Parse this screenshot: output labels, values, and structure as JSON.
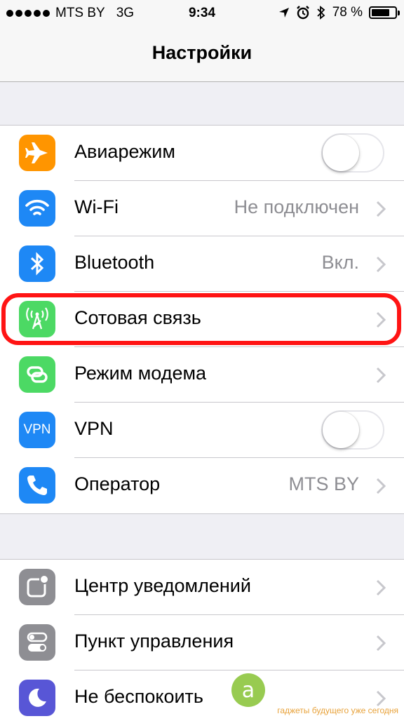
{
  "status_bar": {
    "carrier": "MTS BY",
    "network": "3G",
    "time": "9:34",
    "battery": "78 %",
    "battery_level": 0.78,
    "signal_bars": 5,
    "icons": [
      "location-icon",
      "alarm-icon",
      "bluetooth-icon"
    ]
  },
  "nav": {
    "title": "Настройки"
  },
  "group1": [
    {
      "label": "Авиарежим",
      "icon": "airplane-icon",
      "color": "#ff9500",
      "toggle": false
    },
    {
      "label": "Wi-Fi",
      "icon": "wifi-icon",
      "color": "#1e88f5",
      "value": "Не подключен"
    },
    {
      "label": "Bluetooth",
      "icon": "bluetooth-icon",
      "color": "#1e88f5",
      "value": "Вкл."
    },
    {
      "label": "Сотовая связь",
      "icon": "cellular-icon",
      "color": "#4cd964",
      "value": ""
    },
    {
      "label": "Режим модема",
      "icon": "hotspot-icon",
      "color": "#4cd964",
      "value": ""
    },
    {
      "label": "VPN",
      "icon": "vpn-icon",
      "icon_text": "VPN",
      "color": "#1e88f5",
      "toggle": false
    },
    {
      "label": "Оператор",
      "icon": "phone-icon",
      "color": "#1e88f5",
      "value": "MTS BY"
    }
  ],
  "group2": [
    {
      "label": "Центр уведомлений",
      "icon": "notifications-icon",
      "color": "#8e8e93"
    },
    {
      "label": "Пункт управления",
      "icon": "control-center-icon",
      "color": "#8e8e93"
    },
    {
      "label": "Не беспокоить",
      "icon": "moon-icon",
      "color": "#5856d6"
    }
  ],
  "highlight": {
    "color": "#ff1414"
  },
  "watermark": {
    "glyph": "a",
    "text": "гаджеты будущего уже сегодня"
  }
}
